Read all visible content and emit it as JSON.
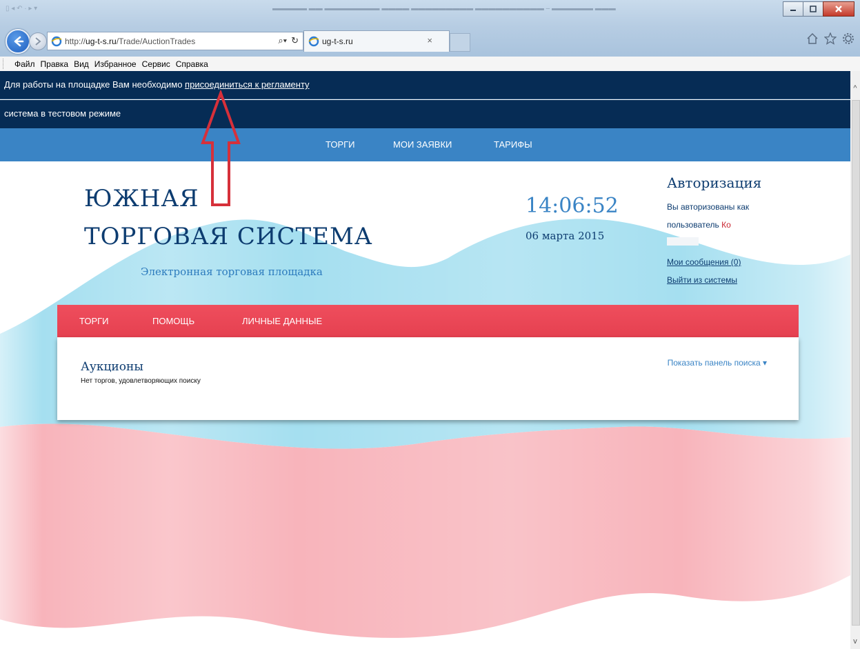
{
  "browser": {
    "url_prefix": "http://",
    "url_host": "ug-t-s.ru",
    "url_path": "/Trade/AuctionTrades",
    "tab_title": "ug-t-s.ru",
    "tab_close": "×"
  },
  "menu": {
    "items": [
      "Файл",
      "Правка",
      "Вид",
      "Избранное",
      "Сервис",
      "Справка"
    ]
  },
  "notice": {
    "text": "Для работы на площадке Вам необходимо ",
    "link": "присоединиться к регламенту"
  },
  "test_mode": "система в тестовом режиме",
  "top_nav": [
    "ТОРГИ",
    "МОИ ЗАЯВКИ",
    "ТАРИФЫ"
  ],
  "logo": {
    "line1": "ЮЖНАЯ",
    "line2": "ТОРГОВАЯ СИСТЕМА",
    "subtitle": "Электронная торговая площадка"
  },
  "clock": {
    "time": "14:06:52",
    "date": "06 марта 2015"
  },
  "auth": {
    "title": "Авторизация",
    "line1": "Вы авторизованы как",
    "line2_prefix": "пользователь ",
    "user": "Ко",
    "messages": "Мои сообщения (0)",
    "logout": "Выйти из системы"
  },
  "section_nav": [
    "ТОРГИ",
    "ПОМОЩЬ",
    "ЛИЧНЫЕ ДАННЫЕ"
  ],
  "content": {
    "title": "Аукционы",
    "empty_text": "Нет торгов, удовлетворяющих поиску",
    "search_toggle": "Показать панель поиска ▾"
  },
  "colors": {
    "header_dark": "#062c55",
    "nav_blue": "#3a84c5",
    "nav_red": "#e54050",
    "flag_blue": "#a5dff0",
    "flag_red": "#f8b4bb",
    "annotation_arrow": "#d6303a"
  }
}
